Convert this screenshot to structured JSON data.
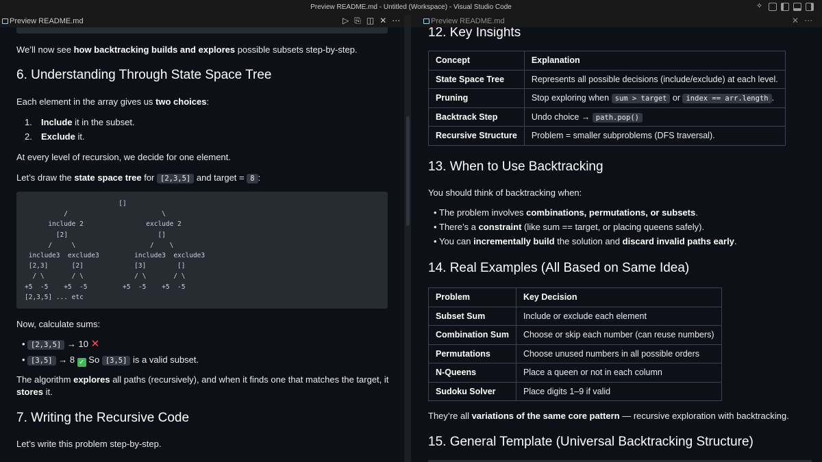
{
  "window": {
    "title": "Preview README.md - Untitled (Workspace) - Visual Studio Code"
  },
  "left_tab": {
    "label": "Preview README.md"
  },
  "right_tab": {
    "label": "Preview README.md"
  },
  "left": {
    "intro_prefix": "We’ll now see ",
    "intro_bold": "how backtracking builds and explores",
    "intro_suffix": " possible subsets step-by-step.",
    "h6": "6. Understanding Through State Space Tree",
    "choices_prefix": "Each element in the array gives us ",
    "choices_bold": "two choices",
    "choices_suffix": ":",
    "list": [
      {
        "num": "1.",
        "bold": "Include",
        "rest": " it in the subset."
      },
      {
        "num": "2.",
        "bold": "Exclude",
        "rest": " it."
      }
    ],
    "level_text": "At every level of recursion, we decide for one element.",
    "draw_prefix": "Let’s draw the ",
    "draw_bold": "state space tree",
    "draw_mid": " for ",
    "draw_code1": "[2,3,5]",
    "draw_mid2": " and target = ",
    "draw_code2": "8",
    "draw_suffix": ":",
    "tree": "                        []\n          /                        \\\n      include 2                exclude 2\n        [2]                       []\n      /     \\                   /    \\\n include3  exclude3         include3  exclude3\n [2,3]      [2]             [3]        []\n  / \\       / \\             / \\       / \\\n+5  -5    +5  -5         +5  -5    +5  -5\n[2,3,5] ... etc",
    "sums_text": "Now, calculate sums:",
    "sum1_code": "[2,3,5]",
    "sum1_text": " → 10 ",
    "sum2_code": "[3,5]",
    "sum2_text": " → 8 ",
    "sum2_so": " So ",
    "sum2_code2": "[3,5]",
    "sum2_end": " is a valid subset.",
    "algo_prefix": "The algorithm ",
    "algo_bold1": "explores",
    "algo_mid": " all paths (recursively), and when it finds one that matches the target, it ",
    "algo_bold2": "stores",
    "algo_end": " it.",
    "h7": "7. Writing the Recursive Code",
    "write_text": "Let’s write this problem step-by-step."
  },
  "right": {
    "h12": "12. Key Insights",
    "insights_headers": [
      "Concept",
      "Explanation"
    ],
    "insights": [
      {
        "k": "State Space Tree",
        "v": "Represents all possible decisions (include/exclude) at each level."
      },
      {
        "k": "Pruning",
        "v_pre": "Stop exploring when ",
        "code1": "sum > target",
        "v_mid": " or ",
        "code2": "index == arr.length",
        "v_end": "."
      },
      {
        "k": "Backtrack Step",
        "v_pre": "Undo choice → ",
        "code1": "path.pop()"
      },
      {
        "k": "Recursive Structure",
        "v": "Problem = smaller subproblems (DFS traversal)."
      }
    ],
    "h13": "13. When to Use Backtracking",
    "think_text": "You should think of backtracking when:",
    "bullets": [
      {
        "pre": "The problem involves ",
        "bold": "combinations, permutations, or subsets",
        "post": "."
      },
      {
        "pre": "There’s a ",
        "bold": "constraint",
        "post": " (like sum == target, or placing queens safely)."
      },
      {
        "pre": "You can ",
        "bold": "incrementally build",
        "mid": " the solution and ",
        "bold2": "discard invalid paths early",
        "post": "."
      }
    ],
    "h14": "14. Real Examples (All Based on Same Idea)",
    "examples_headers": [
      "Problem",
      "Key Decision"
    ],
    "examples": [
      {
        "k": "Subset Sum",
        "v": "Include or exclude each element"
      },
      {
        "k": "Combination Sum",
        "v": "Choose or skip each number (can reuse numbers)"
      },
      {
        "k": "Permutations",
        "v": "Choose unused numbers in all possible orders"
      },
      {
        "k": "N-Queens",
        "v": "Place a queen or not in each column"
      },
      {
        "k": "Sudoku Solver",
        "v": "Place digits 1–9 if valid"
      }
    ],
    "variations_prefix": "They’re all ",
    "variations_bold": "variations of the same core pattern",
    "variations_suffix": " — recursive exploration with backtracking.",
    "h15": "15. General Template (Universal Backtracking Structure)"
  }
}
